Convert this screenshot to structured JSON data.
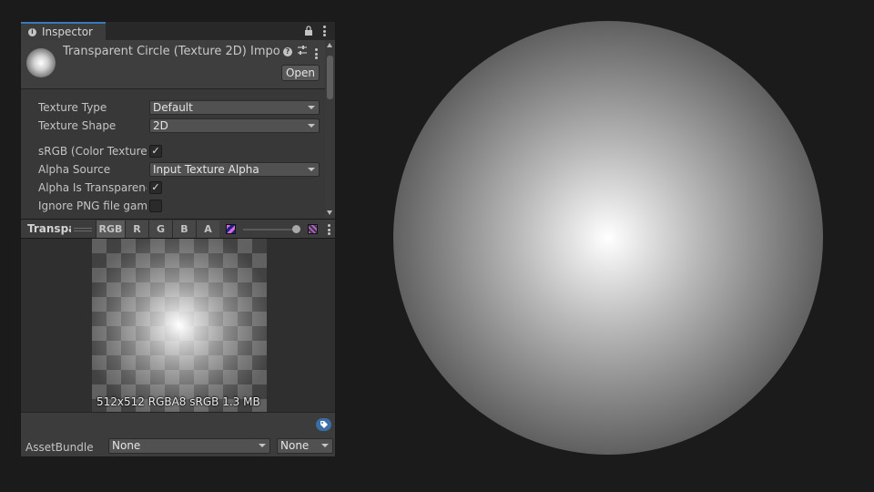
{
  "window": {
    "tab_label": "Inspector"
  },
  "header": {
    "title": "Transparent Circle (Texture 2D) Impo",
    "open_label": "Open"
  },
  "properties": [
    {
      "label": "Texture Type",
      "value": "Default"
    },
    {
      "label": "Texture Shape",
      "value": "2D"
    },
    {
      "label": "sRGB (Color Texture)",
      "checked": true
    },
    {
      "label": "Alpha Source",
      "value": "Input Texture Alpha"
    },
    {
      "label": "Alpha Is Transparenc",
      "checked": true
    },
    {
      "label": "Ignore PNG file gamm",
      "checked": false
    }
  ],
  "preview_toolbar": {
    "title": "Transpa",
    "channels": [
      "RGB",
      "R",
      "G",
      "B",
      "A"
    ],
    "active_channel": "RGB"
  },
  "preview": {
    "info": "512x512  RGBA8 sRGB  1.3 MB"
  },
  "footer": {
    "asset_bundle_label": "AssetBundle",
    "asset_bundle_value": "None",
    "variant_value": "None"
  },
  "icons": {
    "tab": "info-icon",
    "lock": "lock-icon",
    "help": "help-icon",
    "presets": "presets-icon",
    "menu": "kebab-menu-icon",
    "mip": "mip-level-icon",
    "alpha": "alpha-blend-icon",
    "label": "asset-label-icon"
  },
  "colors": {
    "accent": "#3a79bb",
    "panel": "#383838",
    "background": "#1b1b1b"
  }
}
